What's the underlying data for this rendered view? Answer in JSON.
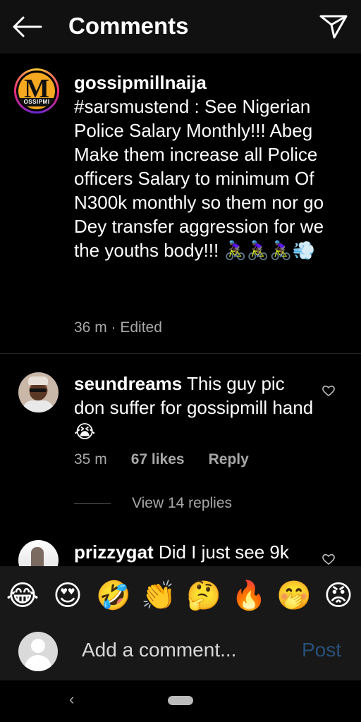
{
  "header": {
    "title": "Comments",
    "back_icon": "arrow-left-icon",
    "share_icon": "paper-plane-icon"
  },
  "caption": {
    "username": "gossipmillnaija",
    "text": "#sarsmustend : See Nigerian Police Salary Monthly!!! Abeg Make them increase all Police officers Salary to minimum Of N300k monthly so them nor go Dey transfer aggression for we the youths body!!! 🚴🏿‍♀️🚴🏿‍♀️🚴🏿‍♀️💨",
    "time": "36 m",
    "separator": " · ",
    "edited": "Edited",
    "avatar_letter": "M",
    "avatar_band": "OSSIPMI"
  },
  "comments": [
    {
      "username": "seundreams",
      "text": "This guy pic don suffer for gossipmill hand😭",
      "time": "35 m",
      "likes": "67 likes",
      "reply": "Reply"
    },
    {
      "username": "prizzygat",
      "text": "Did I just see 9k"
    }
  ],
  "view_replies": "View 14 replies",
  "emoji_bar": [
    "😂",
    "😍",
    "🤣",
    "👏",
    "🤔",
    "🔥",
    "🤭",
    "😡"
  ],
  "compose": {
    "placeholder": "Add a comment...",
    "post_label": "Post"
  },
  "navbar": {
    "back_glyph": "‹"
  },
  "colors": {
    "background": "#000000",
    "bar": "#181818",
    "muted_text": "#a8a8a8",
    "post_disabled": "#28507a"
  }
}
